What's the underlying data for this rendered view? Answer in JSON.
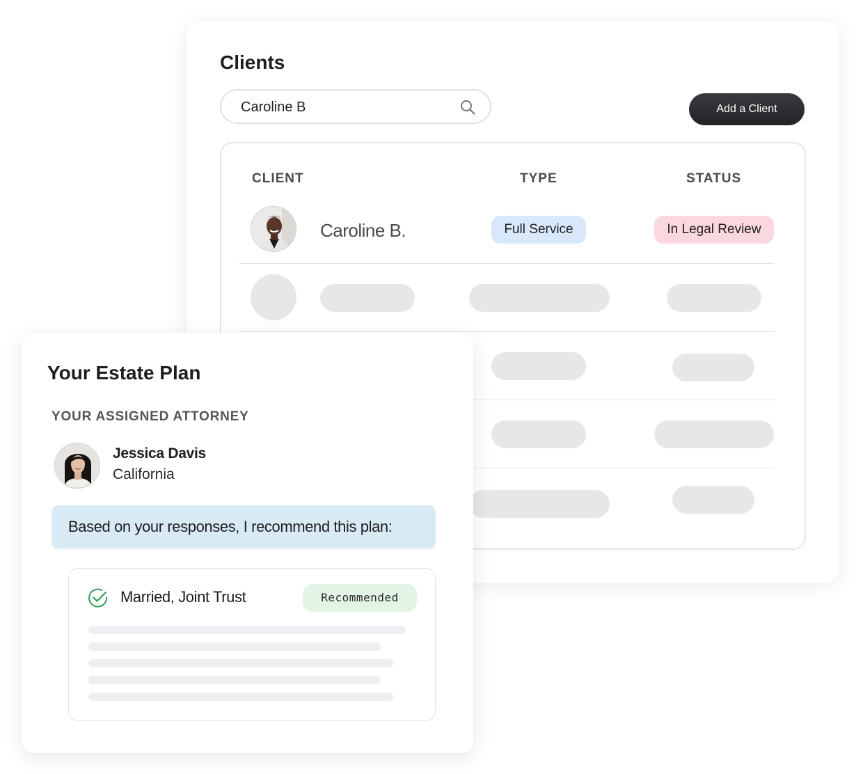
{
  "clients": {
    "title": "Clients",
    "search": {
      "value": "Caroline B",
      "placeholder": ""
    },
    "add_button_label": "Add a Client",
    "columns": {
      "client": "CLIENT",
      "type": "TYPE",
      "status": "STATUS"
    },
    "rows": [
      {
        "name": "Caroline B.",
        "type": "Full Service",
        "status": "In Legal Review"
      }
    ],
    "colors": {
      "type_pill_bg": "#d9e7fb",
      "status_pill_bg": "#fbd8dd",
      "button_bg": "#2a2b2e"
    }
  },
  "estate_plan": {
    "title": "Your Estate Plan",
    "attorney_label": "YOUR ASSIGNED ATTORNEY",
    "attorney": {
      "name": "Jessica Davis",
      "location": "California"
    },
    "message": "Based on your responses, I recommend this plan:",
    "plan": {
      "name": "Married, Joint Trust",
      "badge": "Recommended"
    },
    "colors": {
      "bubble_bg": "#d8ebf5",
      "badge_bg": "#e2f4e6",
      "check_color": "#2e9e54"
    }
  },
  "icons": {
    "search": "search-icon",
    "check": "check-circle-icon"
  }
}
